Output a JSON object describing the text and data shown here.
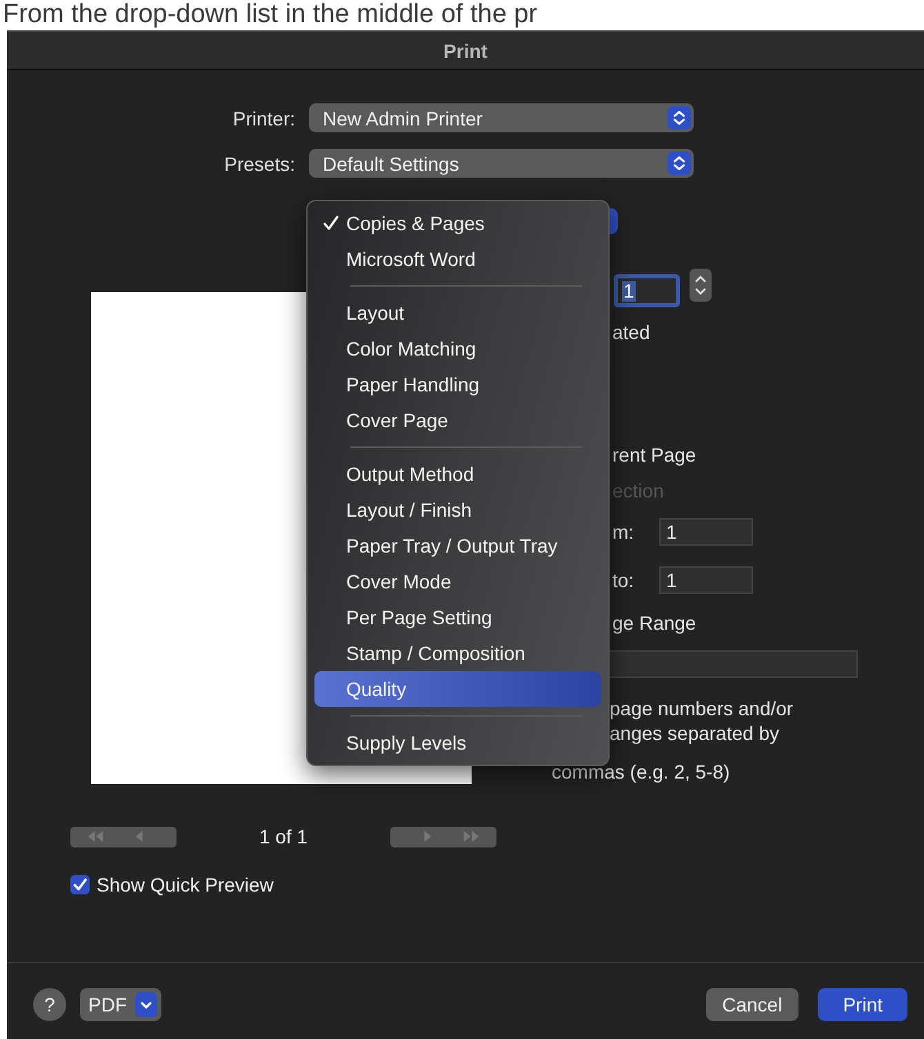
{
  "caption": "From the drop-down list in the middle of the pr",
  "window": {
    "title": "Print"
  },
  "printer": {
    "label": "Printer:",
    "value": "New Admin Printer"
  },
  "presets": {
    "label": "Presets:",
    "value": "Default Settings"
  },
  "menu": [
    {
      "kind": "item",
      "label": "Copies & Pages",
      "checked": true,
      "selected": false
    },
    {
      "kind": "item",
      "label": "Microsoft Word",
      "checked": false,
      "selected": false
    },
    {
      "kind": "separator"
    },
    {
      "kind": "item",
      "label": "Layout",
      "checked": false,
      "selected": false
    },
    {
      "kind": "item",
      "label": "Color Matching",
      "checked": false,
      "selected": false
    },
    {
      "kind": "item",
      "label": "Paper Handling",
      "checked": false,
      "selected": false
    },
    {
      "kind": "item",
      "label": "Cover Page",
      "checked": false,
      "selected": false
    },
    {
      "kind": "separator"
    },
    {
      "kind": "item",
      "label": "Output Method",
      "checked": false,
      "selected": false
    },
    {
      "kind": "item",
      "label": "Layout / Finish",
      "checked": false,
      "selected": false
    },
    {
      "kind": "item",
      "label": "Paper Tray / Output Tray",
      "checked": false,
      "selected": false
    },
    {
      "kind": "item",
      "label": "Cover Mode",
      "checked": false,
      "selected": false
    },
    {
      "kind": "item",
      "label": "Per Page Setting",
      "checked": false,
      "selected": false
    },
    {
      "kind": "item",
      "label": "Stamp / Composition",
      "checked": false,
      "selected": false
    },
    {
      "kind": "item",
      "label": "Quality",
      "checked": false,
      "selected": true
    },
    {
      "kind": "separator"
    },
    {
      "kind": "item",
      "label": "Supply Levels",
      "checked": false,
      "selected": false
    }
  ],
  "copies_value": "1",
  "collated_fragment": "ated",
  "current_page_fragment": {
    "text": "rent Page",
    "disabled": false
  },
  "selection_fragment": {
    "text": "ection",
    "disabled": true
  },
  "from": {
    "label": "m:",
    "value": "1"
  },
  "to": {
    "label": "to:",
    "value": "1"
  },
  "range_fragment": "ge Range",
  "hint_lines": [
    "page numbers and/or",
    "anges separated by",
    "commas (e.g. 2, 5-8)"
  ],
  "page_counter": "1 of 1",
  "quick_preview": {
    "label": "Show Quick Preview",
    "checked": true
  },
  "footer": {
    "help": "?",
    "pdf": "PDF",
    "cancel": "Cancel",
    "print": "Print"
  }
}
